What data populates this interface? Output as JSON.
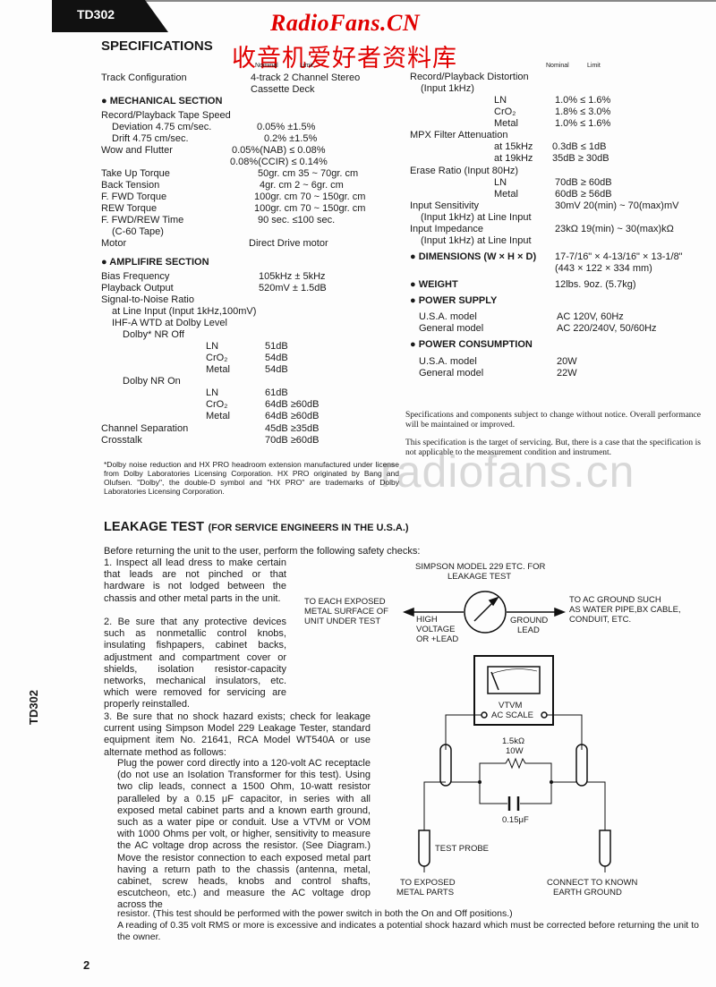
{
  "header": {
    "model_tab": "TD302",
    "watermark_en": "RadioFans.CN",
    "watermark_cn": "收音机爱好者资料库",
    "watermark_mid": "radiofans.cn"
  },
  "specs": {
    "title": "SPECIFICATIONS",
    "col_nominal": "Nominal",
    "col_limit": "Limit",
    "track": {
      "label": "Track Configuration",
      "value1": "4-track 2 Channel Stereo",
      "value2": "Cassette Deck"
    },
    "mechanical": {
      "heading": "MECHANICAL SECTION",
      "rows": [
        {
          "label": "Record/Playback Tape Speed",
          "value": ""
        },
        {
          "label": "Deviation 4.75 cm/sec.",
          "value": "0.05%  ±1.5%"
        },
        {
          "label": "Drift 4.75 cm/sec.",
          "value": "0.2%  ±1.5%"
        },
        {
          "label": "Wow and Flutter",
          "value": "0.05%(NAB) ≤ 0.08%"
        },
        {
          "label": "",
          "value": "0.08%(CCIR) ≤ 0.14%"
        },
        {
          "label": "Take Up Torque",
          "value": "50gr. cm 35 ~ 70gr. cm"
        },
        {
          "label": "Back Tension",
          "value": "4gr. cm   2 ~ 6gr. cm"
        },
        {
          "label": "F. FWD Torque",
          "value": "100gr. cm 70 ~ 150gr. cm"
        },
        {
          "label": "REW Torque",
          "value": "100gr. cm 70 ~ 150gr. cm"
        },
        {
          "label": "F. FWD/REW Time",
          "value": "90 sec. ≤100 sec."
        },
        {
          "label": "(C-60 Tape)",
          "value": ""
        },
        {
          "label": "Motor",
          "value": "Direct Drive motor"
        }
      ]
    },
    "amplifier": {
      "heading": "AMPLIFIRE SECTION",
      "bias": {
        "label": "Bias Frequency",
        "value": "105kHz ± 5kHz"
      },
      "playback": {
        "label": "Playback Output",
        "value": "520mV ± 1.5dB"
      },
      "snr": {
        "label": "Signal-to-Noise Ratio",
        "sub1": "at Line Input (Input 1kHz,100mV)",
        "sub2": "IHF-A WTD at Dolby Level"
      },
      "nr_off": {
        "label": "Dolby* NR Off",
        "rows": [
          {
            "tape": "LN",
            "value": "51dB"
          },
          {
            "tape": "CrO₂",
            "value": "54dB"
          },
          {
            "tape": "Metal",
            "value": "54dB"
          }
        ]
      },
      "nr_on": {
        "label": "Dolby NR On",
        "rows": [
          {
            "tape": "LN",
            "value": "61dB"
          },
          {
            "tape": "CrO₂",
            "value": "64dB  ≥60dB"
          },
          {
            "tape": "Metal",
            "value": "64dB  ≥60dB"
          }
        ]
      },
      "separation": {
        "label": "Channel Separation",
        "value": "45dB  ≥35dB"
      },
      "crosstalk": {
        "label": "Crosstalk",
        "value": "70dB  ≥60dB"
      }
    },
    "footnote": "*Dolby noise reduction and HX PRO headroom extension manufactured under license from Dolby Laboratories Licensing Corporation. HX PRO originated by Bang and Olufsen. \"Dolby\", the double-D symbol and \"HX PRO\" are trademarks of Dolby Laboratories Licensing Corporation.",
    "right": {
      "distortion": {
        "label": "Record/Playback Distortion",
        "sub": "(Input 1kHz)",
        "rows": [
          {
            "tape": "LN",
            "value": "1.0% ≤ 1.6%"
          },
          {
            "tape": "CrO₂",
            "value": "1.8% ≤ 3.0%"
          },
          {
            "tape": "Metal",
            "value": "1.0% ≤ 1.6%"
          }
        ]
      },
      "mpx": {
        "label": "MPX Filter Attenuation",
        "rows": [
          {
            "freq": "at 15kHz",
            "value": "0.3dB ≤ 1dB"
          },
          {
            "freq": "at 19kHz",
            "value": "35dB ≥ 30dB"
          }
        ]
      },
      "erase": {
        "label": "Erase Ratio (Input 80Hz)",
        "rows": [
          {
            "tape": "LN",
            "value": "70dB ≥ 60dB"
          },
          {
            "tape": "Metal",
            "value": "60dB ≥ 56dB"
          }
        ]
      },
      "sensitivity": {
        "label": "Input Sensitivity",
        "sub": "(Input 1kHz) at Line Input",
        "value": "30mV  20(min) ~ 70(max)mV"
      },
      "impedance": {
        "label": "Input Impedance",
        "sub": "(Input 1kHz) at Line Input",
        "value": "23kΩ  19(min) ~ 30(max)kΩ"
      },
      "dimensions": {
        "label": "DIMENSIONS (W × H × D)",
        "value1": "17-7/16\" × 4-13/16\" × 13-1/8\"",
        "value2": "(443  ×  122  ×  334 mm)"
      },
      "weight": {
        "label": "WEIGHT",
        "value": "12lbs. 9oz. (5.7kg)"
      },
      "power_supply": {
        "label": "POWER SUPPLY",
        "rows": [
          {
            "model": "U.S.A. model",
            "value": "AC 120V, 60Hz"
          },
          {
            "model": "General model",
            "value": "AC 220/240V, 50/60Hz"
          }
        ]
      },
      "power_consumption": {
        "label": "POWER CONSUMPTION",
        "rows": [
          {
            "model": "U.S.A. model",
            "value": "20W"
          },
          {
            "model": "General model",
            "value": "22W"
          }
        ]
      },
      "notice1": "Specifications and components subject to change without notice. Overall performance will be maintained or improved.",
      "notice2": "This specification is the target of servicing. But, there is a case that the specification is not applicable to the measurement condition and instrument."
    }
  },
  "leakage": {
    "title": "LEAKAGE TEST",
    "subtitle": "(FOR SERVICE ENGINEERS IN THE U.S.A.)",
    "intro": "Before returning the unit to the user, perform the following safety checks:",
    "item1": "1. Inspect all lead dress to make certain that leads are not pinched or that hardware is not lodged between the chassis and other metal parts in the unit.",
    "item2": "2. Be sure that any protective devices such as nonmetallic control knobs, insulating fishpapers, cabinet backs, adjustment and compartment cover or shields, isolation resistor-capacity networks, mechanical insulators, etc. which were removed for servicing are properly reinstalled.",
    "item3": "3. Be sure that no shock hazard exists; check for leakage current using Simpson Model 229 Leakage Tester, standard equipment item No. 21641, RCA Model WT540A or use alternate method as follows:",
    "item3b": "Plug the power cord directly into a 120-volt AC receptacle (do not use an Isolation Transformer for this test). Using two clip leads, connect a 1500 Ohm, 10-watt resistor paralleled by a 0.15 μF capacitor, in series with all exposed metal cabinet parts and a known earth ground, such as a water pipe or conduit. Use a VTVM or VOM with 1000 Ohms per volt, or higher, sensitivity to measure the AC voltage drop across the resistor. (See Diagram.) Move the resistor connection to each exposed metal part having a return path to the chassis (antenna, metal, cabinet, screw heads, knobs and control shafts, escutcheon, etc.) and measure the AC voltage drop across the",
    "tail1": "resistor. (This test should be performed with the power switch in both the On and Off positions.)",
    "tail2": "A reading of 0.35 volt RMS or more is excessive and indicates a potential shock hazard which must be corrected before returning the unit to the owner.",
    "diagram": {
      "tester_label1": "SIMPSON MODEL 229 ETC. FOR",
      "tester_label2": "LEAKAGE TEST",
      "left1": "TO EACH EXPOSED",
      "left2": "METAL SURFACE OF",
      "left3": "UNIT UNDER TEST",
      "high1": "HIGH",
      "high2": "VOLTAGE",
      "high3": "OR +LEAD",
      "ground1": "GROUND",
      "ground2": "LEAD",
      "right1": "TO AC GROUND SUCH",
      "right2": "AS WATER PIPE,BX CABLE,",
      "right3": "CONDUIT, ETC.",
      "vtvm1": "VTVM",
      "vtvm2": "AC SCALE",
      "resistor1": "1.5kΩ",
      "resistor2": "10W",
      "capacitor": "0.15μF",
      "probe": "TEST PROBE",
      "bl1": "TO EXPOSED",
      "bl2": "METAL PARTS",
      "br1": "CONNECT TO KNOWN",
      "br2": "EARTH GROUND"
    }
  },
  "footer": {
    "page_number": "2",
    "side_label": "TD302"
  }
}
